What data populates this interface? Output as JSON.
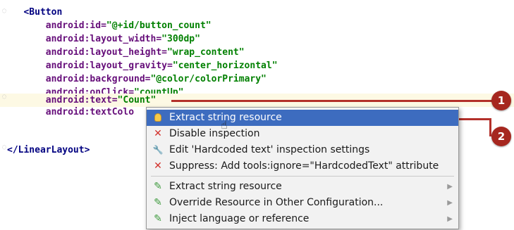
{
  "editor": {
    "lines": [
      {
        "indent": "   ",
        "parts": [
          [
            "tag",
            "<Button"
          ]
        ]
      },
      {
        "indent": "       ",
        "parts": [
          [
            "attr",
            "android:id="
          ],
          [
            "val",
            "\"@+id/button_count\""
          ]
        ]
      },
      {
        "indent": "       ",
        "parts": [
          [
            "attr",
            "android:layout_width="
          ],
          [
            "val",
            "\"300dp\""
          ]
        ]
      },
      {
        "indent": "       ",
        "parts": [
          [
            "attr",
            "android:layout_height="
          ],
          [
            "val",
            "\"wrap_content\""
          ]
        ]
      },
      {
        "indent": "       ",
        "parts": [
          [
            "attr",
            "android:layout_gravity="
          ],
          [
            "val",
            "\"center_horizontal\""
          ]
        ]
      },
      {
        "indent": "       ",
        "parts": [
          [
            "attr",
            "android:background="
          ],
          [
            "val",
            "\"@color/colorPrimary\""
          ]
        ]
      },
      {
        "indent": "       ",
        "parts": [
          [
            "attr",
            "android:onClick="
          ],
          [
            "val",
            "\"countUp\""
          ]
        ]
      },
      {
        "indent": "       ",
        "parts": [
          [
            "attr",
            "android:text="
          ],
          [
            "val",
            "\"Count\""
          ]
        ]
      },
      {
        "indent": "       ",
        "parts": [
          [
            "attr",
            "android:textColo"
          ]
        ]
      },
      {
        "indent": "",
        "parts": []
      },
      {
        "indent": "",
        "parts": [
          [
            "tag",
            "</LinearLayout>"
          ]
        ]
      }
    ]
  },
  "callouts": {
    "one": "1",
    "two": "2"
  },
  "intention_menu": {
    "items": [
      {
        "icon": "lightbulb-icon",
        "label": "Extract string resource",
        "selected": true,
        "submenu": false
      },
      {
        "icon": "x-icon",
        "label": "Disable inspection",
        "selected": false,
        "submenu": false
      },
      {
        "icon": "wrench-icon",
        "label": "Edit 'Hardcoded text' inspection settings",
        "selected": false,
        "submenu": false
      },
      {
        "icon": "x-icon",
        "label": "Suppress: Add tools:ignore=\"HardcodedText\" attribute",
        "selected": false,
        "submenu": false
      },
      {
        "icon": "pencil-icon",
        "label": "Extract string resource",
        "selected": false,
        "submenu": true
      },
      {
        "icon": "pencil-icon",
        "label": "Override Resource in Other Configuration...",
        "selected": false,
        "submenu": true
      },
      {
        "icon": "pencil-icon",
        "label": "Inject language or reference",
        "selected": false,
        "submenu": true
      }
    ]
  },
  "colors": {
    "selection": "#3d6cbf",
    "callout": "#a6271f",
    "highlight_line": "#fdf9e4"
  }
}
